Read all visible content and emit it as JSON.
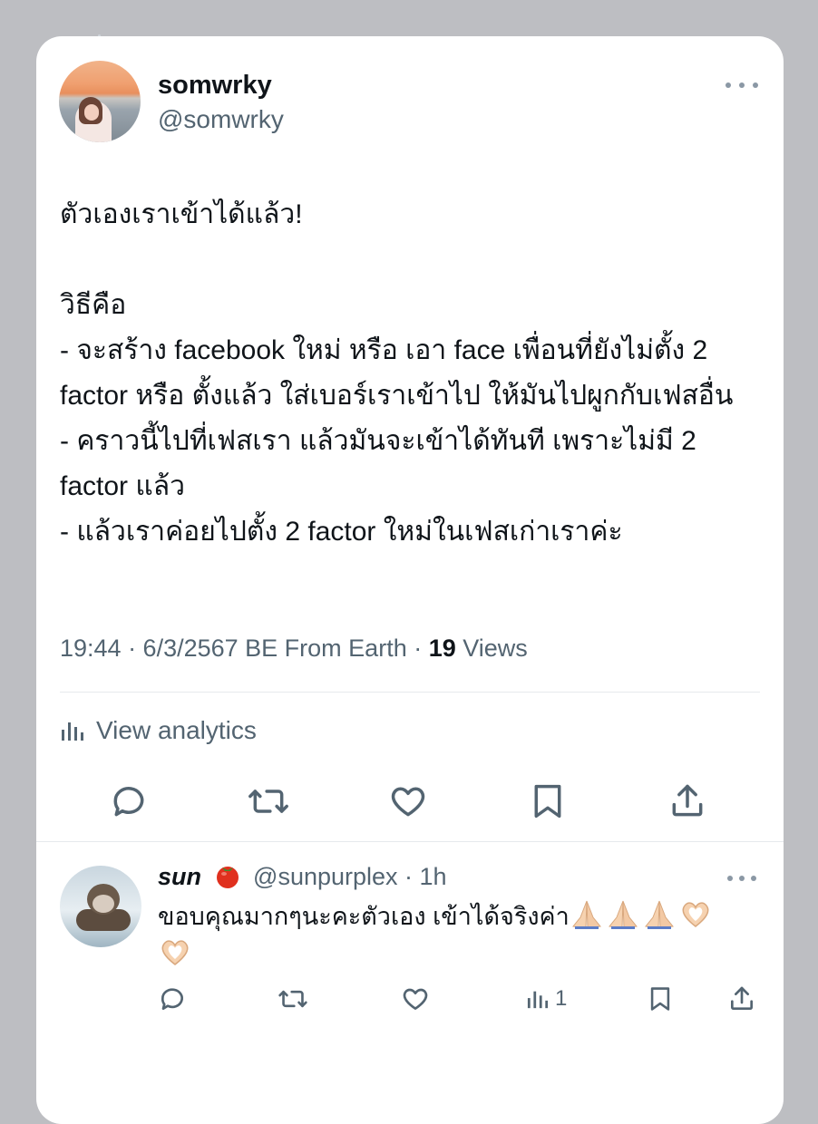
{
  "tweet": {
    "display_name": "somwrky",
    "handle": "@somwrky",
    "text": "ตัวเองเราเข้าได้แล้ว!\n\nวิธีคือ\n- จะสร้าง facebook ใหม่ หรือ เอา face เพื่อนที่ยังไม่ตั้ง 2 factor หรือ ตั้งแล้ว ใส่เบอร์เราเข้าไป ให้มันไปผูกกับเฟสอื่น\n- คราวนี้ไปที่เฟสเรา แล้วมันจะเข้าได้ทันที เพราะไม่มี 2 factor แล้ว\n- แล้วเราค่อยไปตั้ง 2 factor ใหม่ในเฟสเก่าเราค่ะ",
    "timestamp": "19:44 · 6/3/2567 BE From Earth · ",
    "views_count": "19",
    "views_label": " Views",
    "analytics_label": "View analytics",
    "actions": [
      "reply-icon",
      "retweet-icon",
      "like-icon",
      "bookmark-icon",
      "share-icon"
    ]
  },
  "reply": {
    "display_name": "sun",
    "name_emoji": "tomato-emoji",
    "handle_time": "@sunpurplex · 1h",
    "text": "ขอบคุณมากๆนะคะตัวเอง เข้าได้จริงค่า",
    "emojis": [
      "folded-hands",
      "folded-hands",
      "folded-hands",
      "heart-hands",
      "heart-hands"
    ],
    "view_count": "1"
  },
  "colors": {
    "background": "#bdbec2",
    "card": "#ffffff",
    "text_primary": "#0f1419",
    "text_secondary": "#536471"
  }
}
